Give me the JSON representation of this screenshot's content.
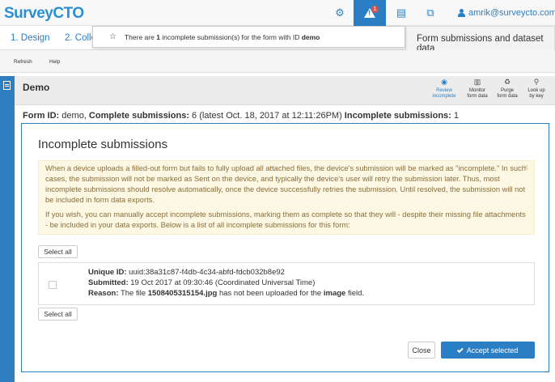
{
  "app": {
    "logo_part1": "Survey",
    "logo_part2": "CTO",
    "user_email": "amrik@surveycto.com",
    "alert_count": "1"
  },
  "tabs": [
    {
      "label": "1. Design"
    },
    {
      "label": "2. Colle"
    }
  ],
  "active_tab": "Form submissions and dataset data",
  "notification": {
    "prefix": "There are ",
    "count": "1",
    "middle": " incomplete submission(s) for the form with ID ",
    "form_id": "demo"
  },
  "toolbar": {
    "refresh": "Refresh",
    "help": "Help"
  },
  "demo": {
    "title": "Demo",
    "actions": [
      {
        "line1": "Review",
        "line2": "incomplete",
        "icon": "eye-icon"
      },
      {
        "line1": "Monitor",
        "line2": "form data",
        "icon": "chart-icon"
      },
      {
        "line1": "Purge",
        "line2": "form data",
        "icon": "recycle-icon"
      },
      {
        "line1": "Look up",
        "line2": "by key",
        "icon": "search-icon"
      }
    ]
  },
  "formid": {
    "label1": "Form ID:",
    "val1": " demo, ",
    "label2": "Complete submissions:",
    "val2": " 6 (latest Oct. 18, 2017 at 12:11:26PM) ",
    "label3": "Incomplete submissions:",
    "val3": " 1"
  },
  "modal": {
    "title": "Incomplete submissions",
    "warn_p1": "When a device uploads a filled-out form but fails to fully upload all attached files, the device's submission will be marked as \"incomplete.\" In such cases, the submission will not be marked as Sent on the device, and typically the device's user will retry the submission later. Thus, most incomplete submissions should resolve automatically, once the device successfully retries the submission. Until resolved, the submission will not be included in form data exports.",
    "warn_p2": "If you wish, you can manually accept incomplete submissions, marking them as complete so that they will - despite their missing file attachments - be included in your data exports. Below is a list of all incomplete submissions for this form:",
    "dismiss": "x",
    "select_all": "Select all",
    "submission": {
      "uid_label": "Unique ID:",
      "uid_value": " uuid:38a31c87-f4db-4c34-abfd-fdcb032b8e92",
      "submitted_label": "Submitted:",
      "submitted_value": " 19 Oct 2017 at 09:30:46 (Coordinated Universal Time)",
      "reason_label": "Reason:",
      "reason_pre": " The file ",
      "reason_file": "1508405315154.jpg",
      "reason_mid": " has not been uploaded for the ",
      "reason_field": "image",
      "reason_post": " field."
    },
    "close": "Close",
    "accept": "Accept selected"
  }
}
